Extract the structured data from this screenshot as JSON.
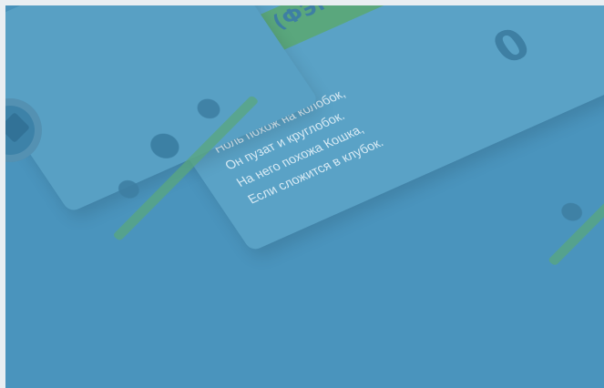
{
  "slide": {
    "title_fragment": "Е (ФЭМП)",
    "poem_lines": [
      "Ноль похож на колобок,",
      "Он пузат и круглобок.",
      "На него похожа Кошка,",
      "Если сложится в клубок."
    ],
    "digit": "0"
  }
}
